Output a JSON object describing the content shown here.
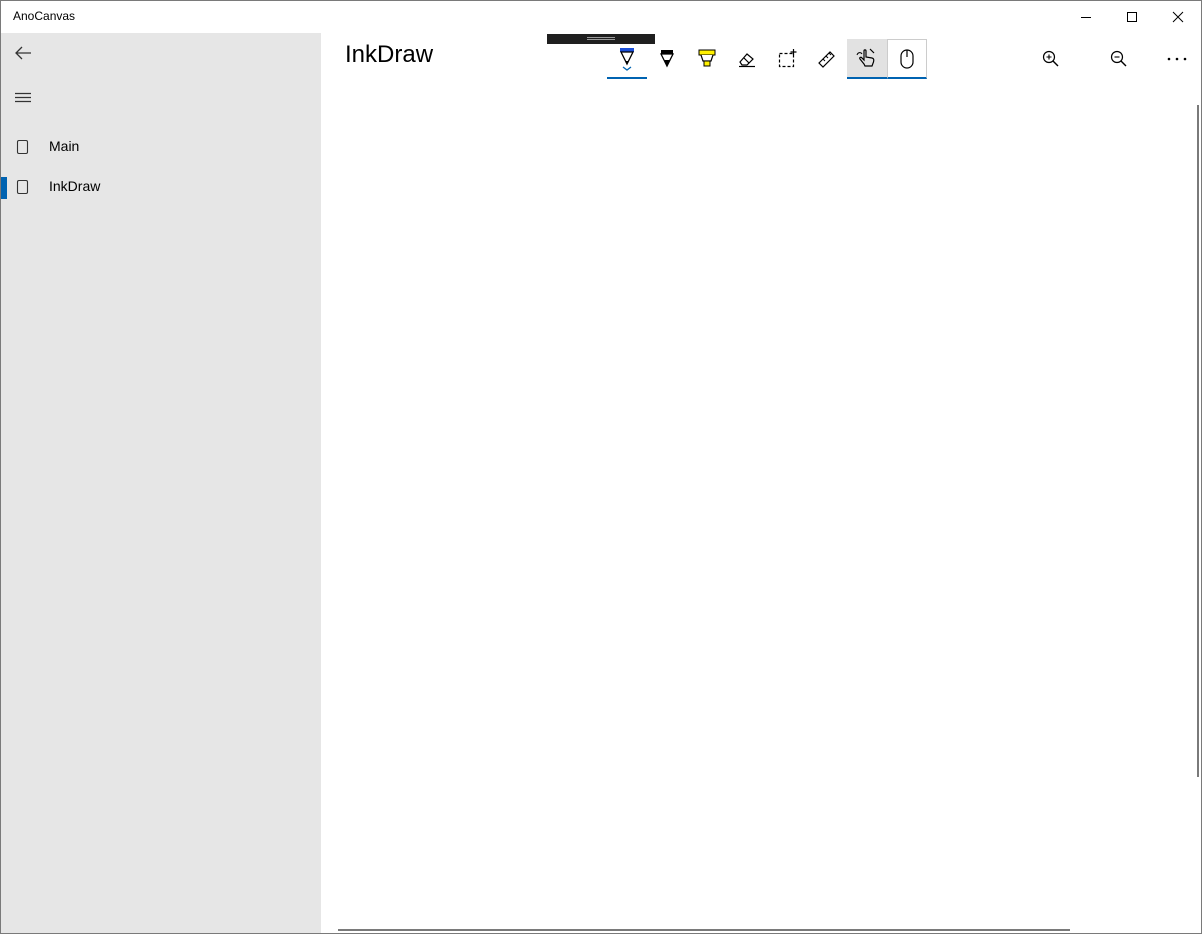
{
  "window": {
    "title": "AnoCanvas"
  },
  "sidebar": {
    "items": [
      {
        "label": "Main",
        "selected": false
      },
      {
        "label": "InkDraw",
        "selected": true
      }
    ]
  },
  "main": {
    "page_title": "InkDraw"
  },
  "inktoolbar": {
    "tools": [
      {
        "name": "ballpoint-pen",
        "color": "#1b4fd8",
        "selected": true
      },
      {
        "name": "pencil",
        "color": "#000000",
        "selected": false
      },
      {
        "name": "highlighter",
        "color": "#fff100",
        "selected": false
      },
      {
        "name": "eraser",
        "selected": false
      },
      {
        "name": "lasso-selection",
        "selected": false
      },
      {
        "name": "ruler",
        "selected": false
      },
      {
        "name": "touch-writing",
        "selected": true
      },
      {
        "name": "mouse-writing",
        "selected": true
      }
    ]
  },
  "commands": [
    "zoom-in",
    "zoom-out",
    "more"
  ],
  "colors": {
    "sidebar_bg": "#e6e6e6",
    "accent": "#0063b1"
  }
}
